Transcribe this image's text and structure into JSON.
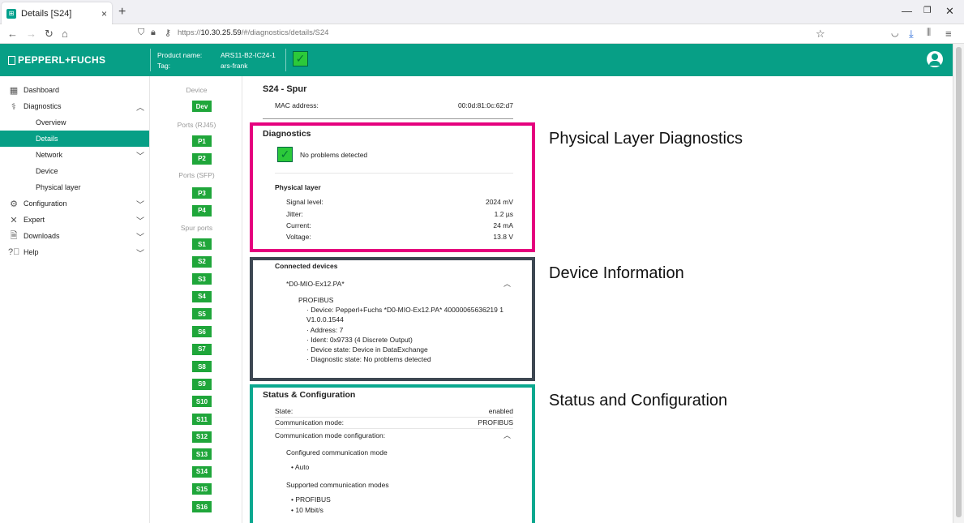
{
  "browser": {
    "tab_title": "Details [S24]",
    "tab_close": "×",
    "new_tab": "+",
    "url_prefix": "https://",
    "url_host": "10.30.25.59",
    "url_path": "/#/diagnostics/details/S24"
  },
  "header": {
    "logo": "PEPPERL+FUCHS",
    "product_name_label": "Product name:",
    "product_name_value": "ARS11-B2-IC24-1",
    "tag_label": "Tag:",
    "tag_value": "ars-frank",
    "status_check": "✓"
  },
  "sidebar": {
    "dashboard": "Dashboard",
    "diagnostics": "Diagnostics",
    "overview": "Overview",
    "details": "Details",
    "network": "Network",
    "device": "Device",
    "physical_layer": "Physical layer",
    "configuration": "Configuration",
    "expert": "Expert",
    "downloads": "Downloads",
    "help": "Help"
  },
  "ports": {
    "device_heading": "Device",
    "dev": "Dev",
    "rj45_heading": "Ports (RJ45)",
    "rj45": [
      "P1",
      "P2"
    ],
    "sfp_heading": "Ports (SFP)",
    "sfp": [
      "P3",
      "P4"
    ],
    "spur_heading": "Spur ports",
    "spur": [
      "S1",
      "S2",
      "S3",
      "S4",
      "S5",
      "S6",
      "S7",
      "S8",
      "S9",
      "S10",
      "S11",
      "S12",
      "S13",
      "S14",
      "S15",
      "S16"
    ]
  },
  "main": {
    "title": "S24 - Spur",
    "mac_label": "MAC address:",
    "mac_value": "00:0d:81:0c:62:d7",
    "diagnostics": {
      "title": "Diagnostics",
      "status": "No problems detected",
      "check": "✓",
      "physical_layer_title": "Physical layer",
      "rows": [
        {
          "label": "Signal level:",
          "value": "2024 mV"
        },
        {
          "label": "Jitter:",
          "value": "1.2 µs"
        },
        {
          "label": "Current:",
          "value": "24 mA"
        },
        {
          "label": "Voltage:",
          "value": "13.8 V"
        }
      ]
    },
    "connected": {
      "title": "Connected devices",
      "device_name": "*D0-MIO-Ex12.PA*",
      "protocol": "PROFIBUS",
      "device_line1": "· Device: Pepperl+Fuchs *D0-MIO-Ex12.PA* 40000065636219 1",
      "device_line2": "V1.0.0.1544",
      "address": "· Address: 7",
      "ident": "· Ident: 0x9733 (4 Discrete Output)",
      "device_state": "· Device state: Device in DataExchange",
      "diagnostic_state": "· Diagnostic state: No problems detected"
    },
    "status": {
      "title": "Status & Configuration",
      "state_label": "State:",
      "state_value": "enabled",
      "comm_mode_label": "Communication mode:",
      "comm_mode_value": "PROFIBUS",
      "comm_config_label": "Communication mode configuration:",
      "configured_title": "Configured communication mode",
      "configured_value": "• Auto",
      "supported_title": "Supported communication modes",
      "supported_values": [
        "• PROFIBUS",
        "• 10 Mbit/s"
      ]
    }
  },
  "annotations": {
    "physical": "Physical Layer Diagnostics",
    "device": "Device Information",
    "status": "Status and Configuration"
  },
  "colors": {
    "brand": "#079f86",
    "port_green": "#1fa63a",
    "highlight_diag": "#e5007e",
    "highlight_device": "#3d4752",
    "highlight_status": "#0aa88f"
  }
}
